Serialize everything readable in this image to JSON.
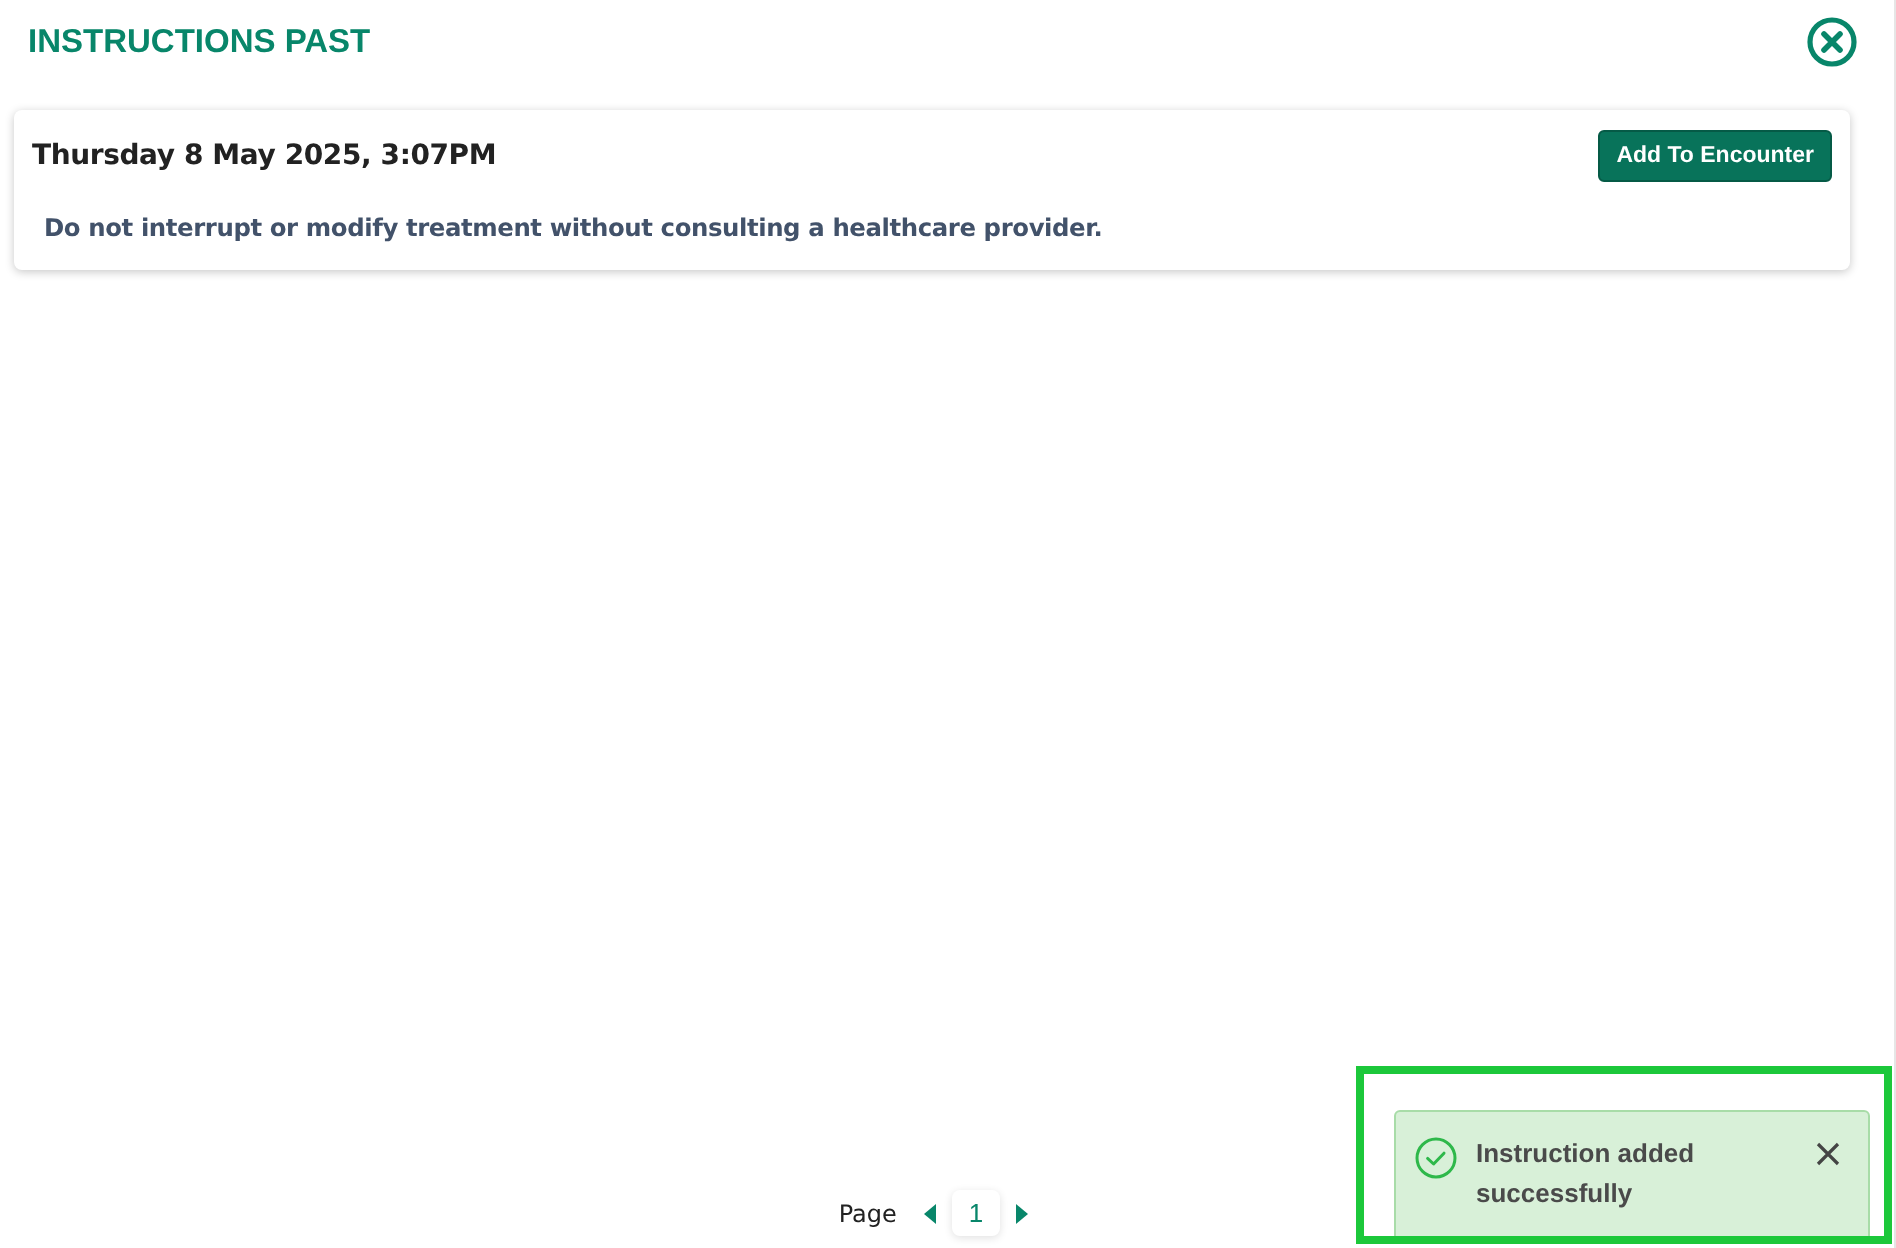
{
  "header": {
    "title": "INSTRUCTIONS PAST"
  },
  "instructions": [
    {
      "date": "Thursday 8 May 2025, 3:07PM",
      "button": "Add To Encounter",
      "text": "Do not interrupt or modify treatment without consulting a healthcare provider."
    }
  ],
  "pagination": {
    "label": "Page",
    "pages": [
      {
        "label": "1",
        "selected": true
      }
    ]
  },
  "toast": {
    "kind": "success",
    "message": "Instruction added successfully",
    "highlighted": true
  }
}
